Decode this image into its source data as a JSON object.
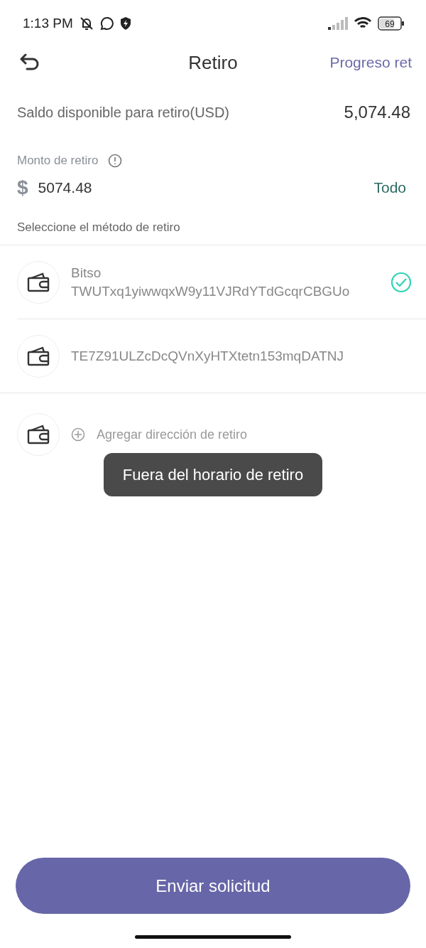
{
  "status_bar": {
    "time": "1:13 PM",
    "battery": "69"
  },
  "header": {
    "title": "Retiro",
    "action": "Progreso ret"
  },
  "balance": {
    "label": "Saldo disponible para retiro(USD)",
    "value": "5,074.48"
  },
  "amount": {
    "label": "Monto de retiro",
    "currency": "$",
    "value": "5074.48",
    "all_button": "Todo"
  },
  "methods_label": "Seleccione el método de retiro",
  "methods": [
    {
      "name": "Bitso",
      "address": "TWUTxq1yiwwqxW9y11VJRdYTdGcqrCBGUo",
      "selected": true
    },
    {
      "address": "TE7Z91ULZcDcQVnXyHTXtetn153mqDATNJ",
      "selected": false
    }
  ],
  "add_address": "Agregar dirección de retiro",
  "toast": "Fuera del horario de retiro",
  "submit": "Enviar solicitud"
}
